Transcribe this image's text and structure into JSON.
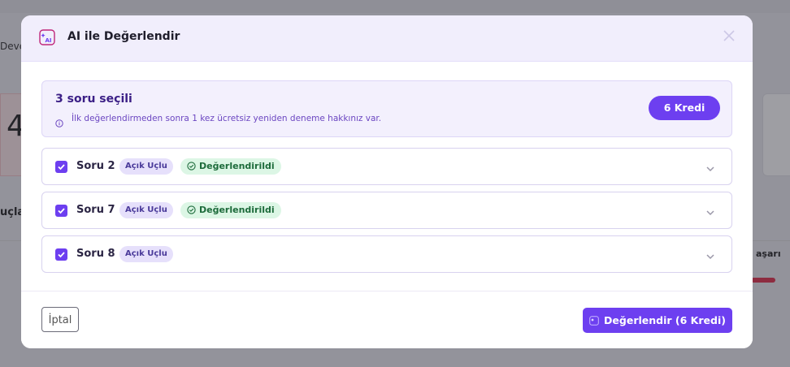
{
  "background": {
    "breadcrumb_fragment": "Deve",
    "big_number_fragment": "4",
    "section_fragment": "uçla",
    "right_label_fragment": "aşarı"
  },
  "modal": {
    "title": "AI ile Değerlendir",
    "ai_icon": "ai-sparkle-icon",
    "close_icon": "close-icon",
    "summary": {
      "title": "3 soru seçili",
      "info": "İlk değerlendirmeden sonra 1 kez ücretsiz yeniden deneme hakkınız var.",
      "credit_badge": "6 Kredi"
    },
    "questions": [
      {
        "label": "Soru 2",
        "type": "Açık Uçlu",
        "status": "Değerlendirildi",
        "checked": true
      },
      {
        "label": "Soru 7",
        "type": "Açık Uçlu",
        "status": "Değerlendirildi",
        "checked": true
      },
      {
        "label": "Soru 8",
        "type": "Açık Uçlu",
        "status": "",
        "checked": true
      }
    ],
    "footer": {
      "cancel_label": "İptal",
      "submit_label": "Değerlendir (6 Kredi)"
    }
  },
  "colors": {
    "accent": "#6d3ff0",
    "header_bg": "#f1eefc",
    "status_green_bg": "#dcf6e5",
    "status_green_text": "#1d6b3b",
    "chip_bg": "#e6e0fb"
  }
}
